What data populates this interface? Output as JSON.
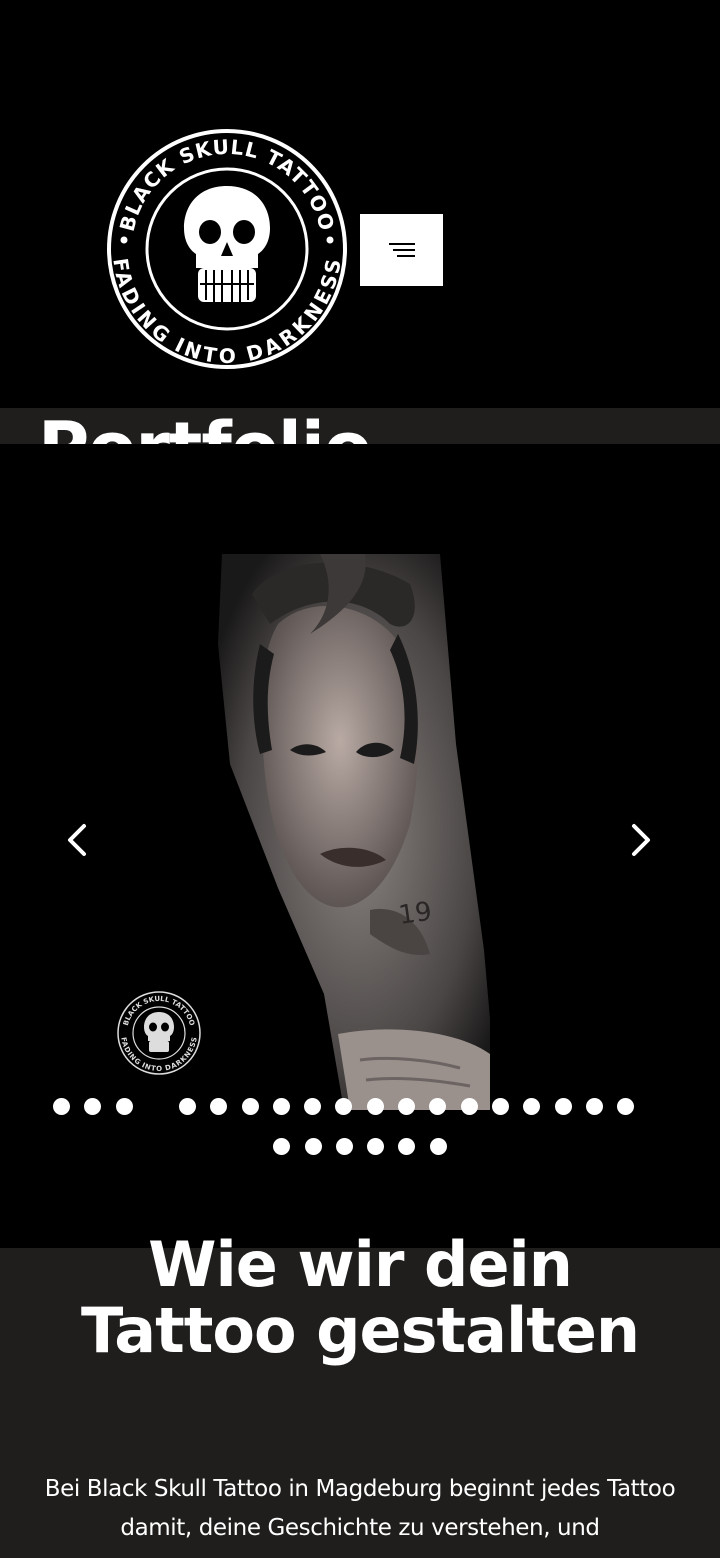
{
  "header": {
    "logo": {
      "top_text": "BLACK SKULL TATTOO",
      "bottom_text": "FADING INTO DARKNESS",
      "icon": "skull-icon"
    },
    "menu_button": {
      "icon": "hamburger-menu-icon"
    }
  },
  "portfolio": {
    "title": "Portfolio"
  },
  "slider": {
    "slide_image": "tattoo-forearm-portrait-image",
    "prev_icon": "chevron-left-icon",
    "next_icon": "chevron-right-icon",
    "watermark": {
      "top_text": "BLACK SKULL TATTOO",
      "bottom_text": "FADING INTO DARKNESS"
    },
    "dots_row1_count": 19,
    "dots_row2_count": 6,
    "active_dot_index": 3
  },
  "process": {
    "heading": "Wie wir dein Tattoo gestalten",
    "text": "Bei Black Skull Tattoo in Magdeburg beginnt jedes Tattoo damit, deine Geschichte zu verstehen, und"
  },
  "colors": {
    "background": "#000000",
    "band": "#1f1e1d",
    "text": "#ffffff",
    "menu_button": "#ffffff"
  }
}
